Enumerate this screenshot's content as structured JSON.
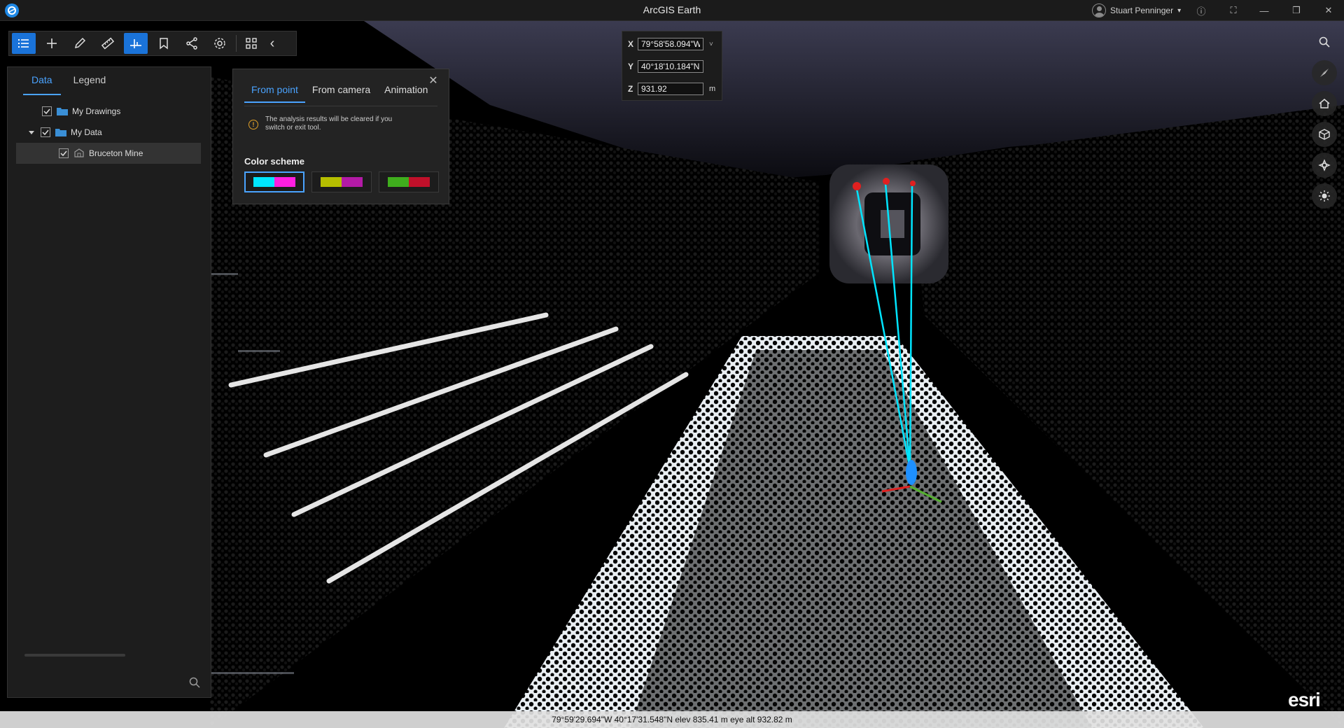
{
  "window": {
    "title": "ArcGIS Earth",
    "user_name": "Stuart Penninger",
    "user_caret": "▾",
    "info_glyph": "ⓘ",
    "fullscreen_glyph": "⛶",
    "minimize_glyph": "—",
    "restore_glyph": "❐",
    "close_glyph": "✕"
  },
  "toolbar": {
    "collapse_glyph": "‹",
    "icons": [
      "list-icon",
      "add-icon",
      "draw-icon",
      "measure-icon",
      "analysis-icon",
      "bookmark-icon",
      "share-icon",
      "settings-icon",
      "apps-icon"
    ]
  },
  "sidepanel": {
    "tabs": [
      {
        "label": "Data",
        "active": true
      },
      {
        "label": "Legend",
        "active": false
      }
    ],
    "items": [
      {
        "label": "My Drawings"
      },
      {
        "label": "My Data"
      },
      {
        "label": "Bruceton Mine"
      }
    ]
  },
  "line_of_sight": {
    "close_glyph": "✕",
    "tabs": [
      {
        "label": "From point",
        "active": true
      },
      {
        "label": "From camera",
        "active": false
      },
      {
        "label": "Animation",
        "active": false
      }
    ],
    "warning_glyph": "!",
    "warning": "The analysis results will be cleared if you switch or exit tool.",
    "color_scheme_label": "Color scheme",
    "schemes": [
      {
        "colors": [
          "#00e5ff",
          "#ff1ee0"
        ],
        "selected": true
      },
      {
        "colors": [
          "#b5be00",
          "#b31aa6"
        ],
        "selected": false
      },
      {
        "colors": [
          "#3fae1d",
          "#c0102a"
        ],
        "selected": false
      }
    ]
  },
  "coordinates": {
    "x_label": "X",
    "x_value": "79°58'58.094\"W",
    "y_label": "Y",
    "y_value": "40°18'10.184\"N",
    "z_label": "Z",
    "z_value": "931.92",
    "z_unit": "m",
    "dropdown_glyph": "˅"
  },
  "right_rail": {
    "icons": [
      "search-icon",
      "compass-icon",
      "home-icon",
      "3d-view-icon",
      "navigate-icon",
      "sun-icon"
    ]
  },
  "statusbar": {
    "text": "79°59'29.694\"W 40°17'31.548\"N   elev 835.41 m   eye alt 932.82 m"
  },
  "branding": {
    "logo_text": "esri"
  },
  "colors": {
    "accent": "#1a73d9",
    "accent_text": "#4aa3ff",
    "sight_line": "#00e5ff"
  }
}
